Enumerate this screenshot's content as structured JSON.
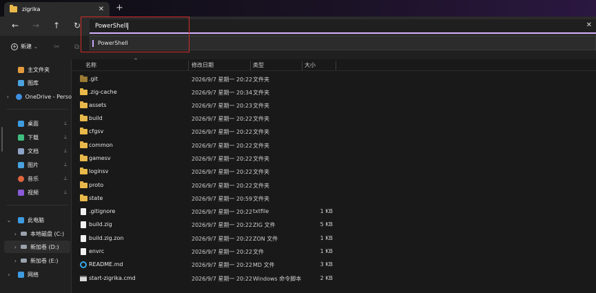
{
  "tab": {
    "title": "zigrika",
    "close": "✕",
    "new": "+"
  },
  "nav": {
    "back": "←",
    "forward": "→",
    "up": "↑",
    "refresh": "↻"
  },
  "address": {
    "value": "PowerShell",
    "clear": "✕"
  },
  "suggestion": {
    "label": "PowerShell"
  },
  "toolbar": {
    "new_label": "新建",
    "new_chevron": "⌄",
    "cut": "✂",
    "copy": "⧉"
  },
  "sidebar": {
    "items": [
      {
        "label": "主文件夹",
        "icon": "home-icon",
        "color": "#e39b3d"
      },
      {
        "label": "图库",
        "icon": "gallery-icon",
        "color": "#4aa3e0"
      },
      {
        "label": "OneDrive - Perso",
        "icon": "cloud-icon",
        "color": "#3f8fe0"
      },
      {
        "label": "桌面",
        "icon": "desktop-icon",
        "color": "#3e9be0"
      },
      {
        "label": "下载",
        "icon": "download-icon",
        "color": "#3fbf7f"
      },
      {
        "label": "文档",
        "icon": "document-icon",
        "color": "#8ea4c7"
      },
      {
        "label": "图片",
        "icon": "picture-icon",
        "color": "#4aa3e0"
      },
      {
        "label": "音乐",
        "icon": "music-icon",
        "color": "#e0643e"
      },
      {
        "label": "视频",
        "icon": "video-icon",
        "color": "#8a5ad8"
      },
      {
        "label": "此电脑",
        "icon": "computer-icon",
        "color": "#3e9be0"
      },
      {
        "label": "本地磁盘 (C:)",
        "icon": "drive-icon",
        "color": "#9aa3ad"
      },
      {
        "label": "新加卷 (D:)",
        "icon": "drive-icon",
        "color": "#9aa3ad"
      },
      {
        "label": "新加卷 (E:)",
        "icon": "drive-icon",
        "color": "#9aa3ad"
      },
      {
        "label": "网络",
        "icon": "network-icon",
        "color": "#3e9be0"
      }
    ],
    "pin": "📌"
  },
  "columns": {
    "name": "名称",
    "date": "修改日期",
    "type": "类型",
    "size": "大小",
    "sort_arrow": "^"
  },
  "files": [
    {
      "name": ".git",
      "date": "2026/9/7 星期一 20:22",
      "type": "文件夹",
      "size": "",
      "icon": "folder-icon"
    },
    {
      "name": ".zig-cache",
      "date": "2026/9/7 星期一 20:34",
      "type": "文件夹",
      "size": "",
      "icon": "folder-icon"
    },
    {
      "name": "assets",
      "date": "2026/9/7 星期一 20:23",
      "type": "文件夹",
      "size": "",
      "icon": "folder-icon"
    },
    {
      "name": "build",
      "date": "2026/9/7 星期一 20:22",
      "type": "文件夹",
      "size": "",
      "icon": "folder-icon"
    },
    {
      "name": "cfgsv",
      "date": "2026/9/7 星期一 20:22",
      "type": "文件夹",
      "size": "",
      "icon": "folder-icon"
    },
    {
      "name": "common",
      "date": "2026/9/7 星期一 20:22",
      "type": "文件夹",
      "size": "",
      "icon": "folder-icon"
    },
    {
      "name": "gamesv",
      "date": "2026/9/7 星期一 20:22",
      "type": "文件夹",
      "size": "",
      "icon": "folder-icon"
    },
    {
      "name": "loginsv",
      "date": "2026/9/7 星期一 20:22",
      "type": "文件夹",
      "size": "",
      "icon": "folder-icon"
    },
    {
      "name": "proto",
      "date": "2026/9/7 星期一 20:22",
      "type": "文件夹",
      "size": "",
      "icon": "folder-icon"
    },
    {
      "name": "state",
      "date": "2026/9/7 星期一 20:59",
      "type": "文件夹",
      "size": "",
      "icon": "folder-icon"
    },
    {
      "name": ".gitignore",
      "date": "2026/9/7 星期一 20:22",
      "type": "txtfile",
      "size": "1 KB",
      "icon": "file-icon"
    },
    {
      "name": "build.zig",
      "date": "2026/9/7 星期一 20:22",
      "type": "ZIG 文件",
      "size": "5 KB",
      "icon": "file-icon"
    },
    {
      "name": "build.zig.zon",
      "date": "2026/9/7 星期一 20:22",
      "type": "ZON 文件",
      "size": "1 KB",
      "icon": "file-icon"
    },
    {
      "name": "envrc",
      "date": "2026/9/7 星期一 20:22",
      "type": "文件",
      "size": "1 KB",
      "icon": "file-icon"
    },
    {
      "name": "README.md",
      "date": "2026/9/7 星期一 20:22",
      "type": "MD 文件",
      "size": "3 KB",
      "icon": "markdown-icon"
    },
    {
      "name": "start-zigrika.cmd",
      "date": "2026/9/7 星期一 20:22",
      "type": "Windows 命令脚本",
      "size": "2 KB",
      "icon": "cmd-script-icon"
    }
  ]
}
